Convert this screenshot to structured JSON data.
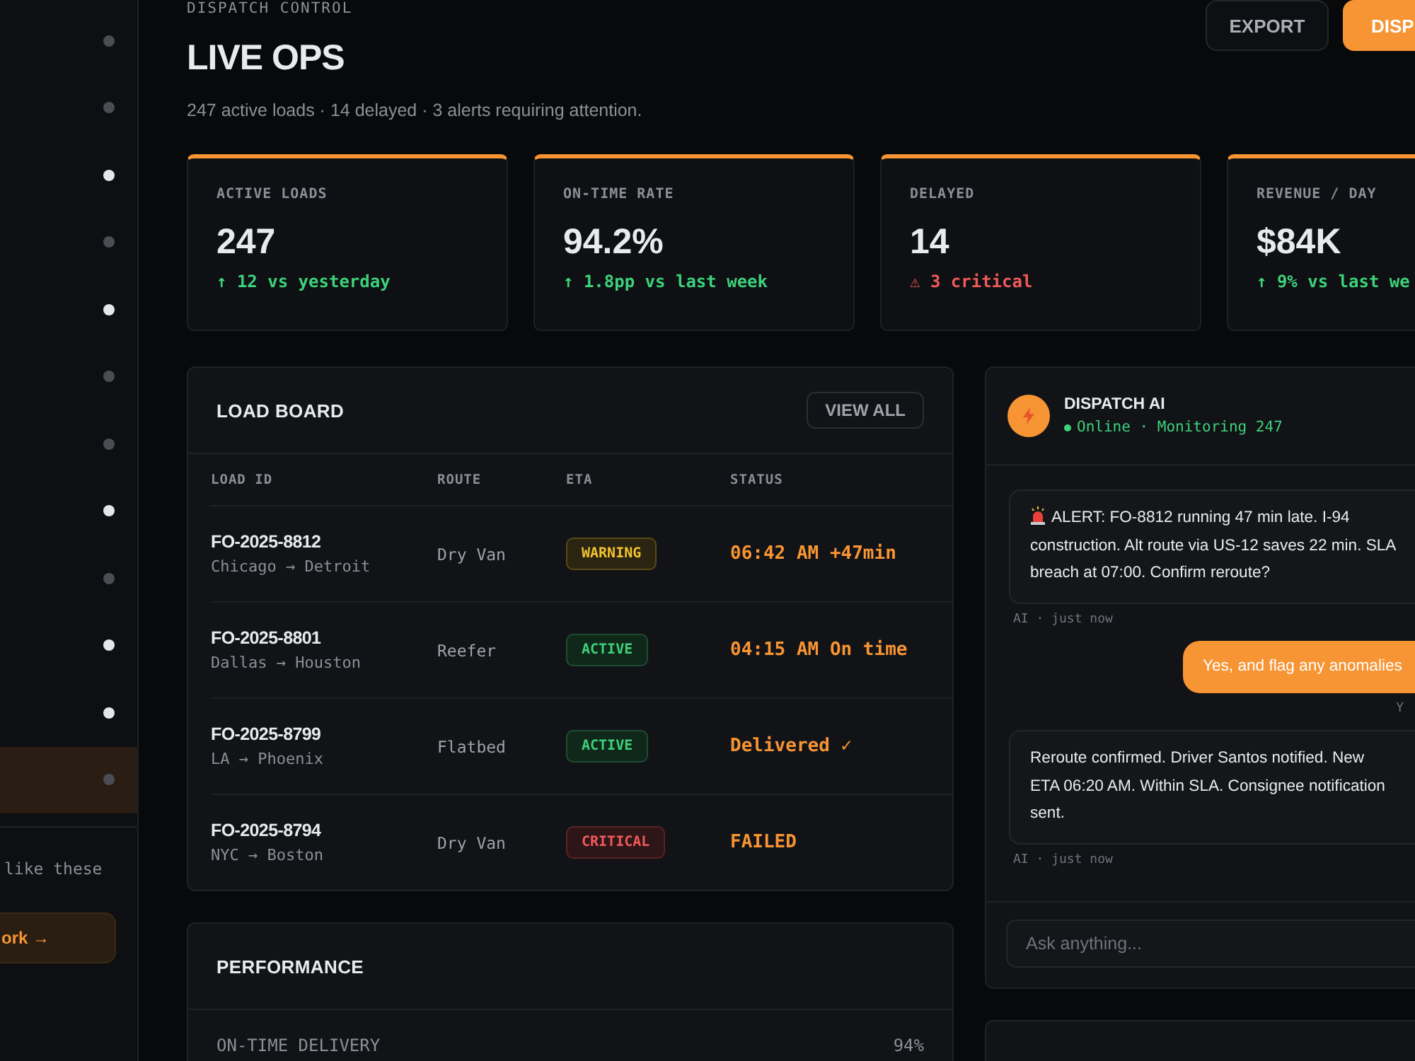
{
  "sidebar": {
    "items": [
      {
        "on": false,
        "selected": false
      },
      {
        "on": false,
        "selected": false
      },
      {
        "on": true,
        "selected": false
      },
      {
        "on": false,
        "selected": false
      },
      {
        "on": true,
        "selected": false
      },
      {
        "on": false,
        "selected": false
      },
      {
        "on": false,
        "selected": false
      },
      {
        "on": true,
        "selected": false
      },
      {
        "on": false,
        "selected": false
      },
      {
        "on": true,
        "selected": false
      },
      {
        "on": true,
        "selected": false
      },
      {
        "on": false,
        "selected": true
      }
    ],
    "promo_text": "like these",
    "promo_button": "ork →"
  },
  "header": {
    "eyebrow": "DISPATCH CONTROL",
    "title": "LIVE OPS",
    "subtitle": "247 active loads · 14 delayed · 3 alerts requiring attention.",
    "buttons": [
      {
        "label": "EXPORT",
        "kind": "secondary"
      },
      {
        "label": "DISP",
        "kind": "primary"
      }
    ]
  },
  "kpis": [
    {
      "label": "ACTIVE LOADS",
      "value": "247",
      "delta": "↑ 12 vs yesterday",
      "kind": "good"
    },
    {
      "label": "ON-TIME RATE",
      "value": "94.2%",
      "delta": "↑ 1.8pp vs last week",
      "kind": "good"
    },
    {
      "label": "DELAYED",
      "value": "14",
      "delta": "⚠ 3 critical",
      "kind": "bad"
    },
    {
      "label": "REVENUE / DAY",
      "value": "$84K",
      "delta": "↑ 9% vs last we",
      "kind": "good"
    }
  ],
  "load_board": {
    "title": "LOAD BOARD",
    "action": "VIEW ALL",
    "columns": [
      "LOAD ID",
      "ROUTE",
      "ETA",
      "STATUS"
    ],
    "rows": [
      {
        "id": "FO-2025-8812",
        "lane": "Chicago → Detroit",
        "equipment": "Dry Van",
        "badge": "WARNING",
        "kind": "warning",
        "status": "06:42 AM +47min"
      },
      {
        "id": "FO-2025-8801",
        "lane": "Dallas → Houston",
        "equipment": "Reefer",
        "badge": "ACTIVE",
        "kind": "active",
        "status": "04:15 AM On time"
      },
      {
        "id": "FO-2025-8799",
        "lane": "LA → Phoenix",
        "equipment": "Flatbed",
        "badge": "ACTIVE",
        "kind": "active",
        "status": "Delivered ✓"
      },
      {
        "id": "FO-2025-8794",
        "lane": "NYC → Boston",
        "equipment": "Dry Van",
        "badge": "CRITICAL",
        "kind": "critical",
        "status": "FAILED"
      }
    ]
  },
  "performance": {
    "title": "PERFORMANCE",
    "metrics": [
      {
        "label": "ON-TIME DELIVERY",
        "value": "94%"
      }
    ]
  },
  "chat": {
    "name": "DISPATCH AI",
    "status": "Online · Monitoring 247",
    "messages": [
      {
        "kind": "ai",
        "alert": true,
        "lines": [
          "ALERT: FO-8812 running 47 min late. I-94",
          "construction. Alt route via US-12 saves 22 min. SLA",
          "breach at 07:00. Confirm reroute?"
        ],
        "meta": "AI · just now"
      },
      {
        "kind": "user",
        "alert": false,
        "lines": [
          "Yes, and flag any anomalies"
        ],
        "meta": "Y"
      },
      {
        "kind": "ai",
        "alert": false,
        "lines": [
          "Reroute confirmed. Driver Santos notified. New",
          "ETA 06:20 AM. Within SLA. Consignee notification",
          "sent."
        ],
        "meta": "AI · just now"
      }
    ],
    "input_placeholder": "Ask anything..."
  }
}
